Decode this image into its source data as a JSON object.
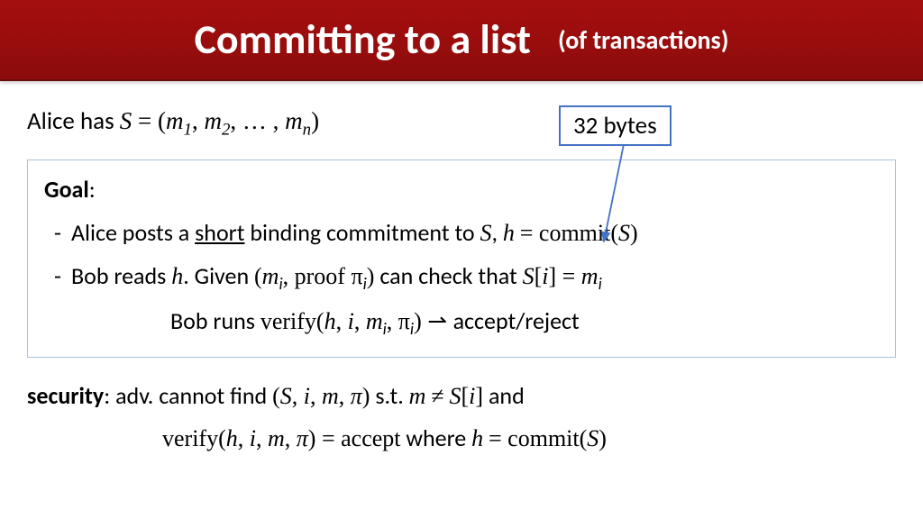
{
  "header": {
    "title_main": "Committing to a list",
    "title_sub": "(of transactions)"
  },
  "callout": {
    "label": "32 bytes"
  },
  "line1": {
    "prefix": "Alice has   ",
    "eq": "S = (m₁, m₂, … , mₙ)"
  },
  "goal": {
    "title": "Goal",
    "bullet1_a": "Alice posts a ",
    "bullet1_underline": "short",
    "bullet1_b": " binding commitment to ",
    "bullet1_c": "S",
    "bullet1_d": ",   ",
    "bullet1_e": "h = commit(S)",
    "bullet2_a": "Bob reads ",
    "bullet2_b": "h",
    "bullet2_c": ".     Given   ",
    "bullet2_d": "(mᵢ,  proof πᵢ)",
    "bullet2_e": "   can check that   ",
    "bullet2_f": "S[i] = mᵢ",
    "bobline_a": "Bob runs    ",
    "bobline_b": "verify(h, i, mᵢ, πᵢ) ⇀ ",
    "bobline_c": "accept/reject"
  },
  "security": {
    "label": "security",
    "line1_a": ":   adv. cannot find  ",
    "line1_b": "(S, i, m, π)",
    "line1_c": "    s.t.    ",
    "line1_d": "m ≠ S[i]",
    "line1_e": "    and",
    "line2_a": "verify(h, i, m, π) = accept",
    "line2_b": "    where   ",
    "line2_c": "h = commit(S)"
  }
}
